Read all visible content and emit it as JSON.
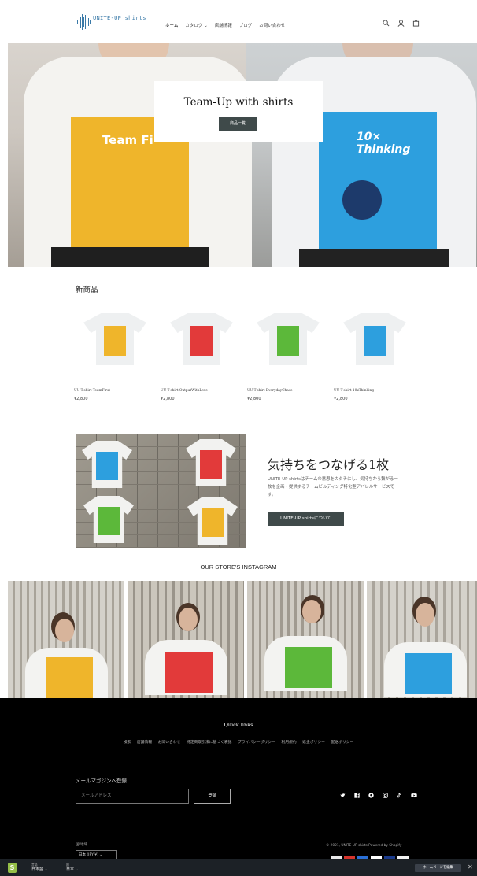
{
  "header": {
    "logo_text": "UNITE-UP shirts",
    "nav": [
      {
        "label": "ホーム",
        "active": true
      },
      {
        "label": "カタログ ⌄",
        "active": false
      },
      {
        "label": "店舗情報",
        "active": false
      },
      {
        "label": "ブログ",
        "active": false
      },
      {
        "label": "お問い合わせ",
        "active": false
      }
    ],
    "icons": [
      "search-icon",
      "account-icon",
      "cart-icon"
    ]
  },
  "hero": {
    "title": "Team-Up with shirts",
    "button": "商品一覧",
    "left_print": "Team Fi",
    "right_print": "10× Thinking"
  },
  "new_products": {
    "title": "新商品",
    "items": [
      {
        "name": "UU T-shirt TeamFirst",
        "price": "¥2,800",
        "color": "#efb52b"
      },
      {
        "name": "UU T-shirt OutputWithLove",
        "price": "¥2,800",
        "color": "#e23a3a"
      },
      {
        "name": "UU T-shirt EverydayChase",
        "price": "¥2,800",
        "color": "#5cb83a"
      },
      {
        "name": "UU T-shirt 10xThinking",
        "price": "¥2,800",
        "color": "#2d9fde"
      }
    ]
  },
  "feature": {
    "heading": "気持ちをつなげる1枚",
    "body": "UNITE-UP shirtsはチームの意思をカタチにし、気持ちから繋がる一枚を企画・提供するチームビルディング特化型アパレルサービスです。",
    "button": "UNITE-UP shirtsについて"
  },
  "instagram": {
    "title": "OUR STORE'S INSTAGRAM",
    "posts": [
      {
        "print_color": "#efb52b"
      },
      {
        "print_color": "#e23a3a"
      },
      {
        "print_color": "#5cb83a"
      },
      {
        "print_color": "#2d9fde"
      }
    ]
  },
  "footer": {
    "quick_links_title": "Quick links",
    "links": [
      "検索",
      "店舗情報",
      "お問い合わせ",
      "特定商取引法に基づく表記",
      "プライバシーポリシー",
      "利用規約",
      "返金ポリシー",
      "配送ポリシー"
    ],
    "newsletter_title": "メールマガジンへ登録",
    "email_placeholder": "メールアドレス",
    "subscribe_button": "登録",
    "social_icons": [
      "twitter-icon",
      "facebook-icon",
      "pinterest-icon",
      "instagram-icon",
      "tiktok-icon",
      "youtube-icon"
    ],
    "region_label": "国/地域",
    "region_value": "日本 (JPY ¥) ⌄",
    "copyright": "© 2021, UNITE-UP shirts Powered by Shopify",
    "payment_colors": [
      "#e8e8e8",
      "#d6342c",
      "#2a6fd6",
      "#ffffff",
      "#1a3a8c",
      "#f2f2f2"
    ]
  },
  "admin_bar": {
    "lang1_label": "言語",
    "lang1_value": "日本語 ⌄",
    "lang2_label": "国",
    "lang2_value": "日本 ⌄",
    "edit_button": "ホームページを編集",
    "close": "✕"
  },
  "colors": {
    "accent": "#3f4a4a",
    "logo": "#3a7aa8",
    "footer_bg": "#000000"
  }
}
